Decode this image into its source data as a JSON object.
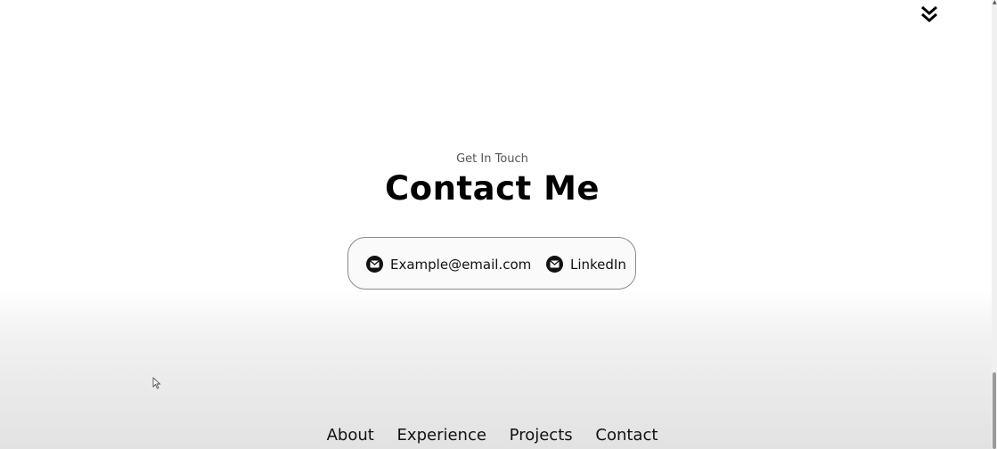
{
  "contact": {
    "subtitle": "Get In Touch",
    "title": "Contact Me",
    "email_label": "Example@email.com",
    "linkedin_label": "LinkedIn"
  },
  "nav": {
    "items": [
      "About",
      "Experience",
      "Projects",
      "Contact"
    ]
  },
  "icons": {
    "scroll": "double-chevron-down-icon",
    "email": "mail-icon",
    "linkedin": "mail-icon"
  }
}
